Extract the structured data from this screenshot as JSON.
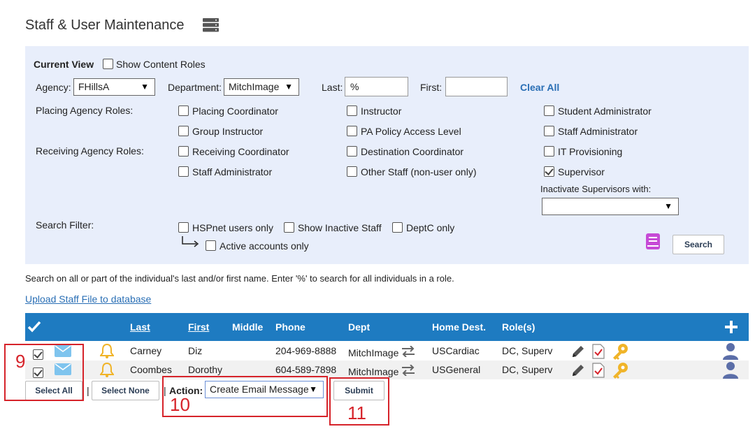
{
  "header": {
    "title": "Staff & User Maintenance",
    "title_icon": "server-icon"
  },
  "filters": {
    "current_view_label": "Current View",
    "show_content_roles": {
      "label": "Show Content Roles",
      "checked": false
    },
    "agency": {
      "label": "Agency:",
      "value": "FHillsA"
    },
    "department": {
      "label": "Department:",
      "value": "MitchImage"
    },
    "last": {
      "label": "Last:",
      "value": "%"
    },
    "first": {
      "label": "First:",
      "value": ""
    },
    "clear_all": "Clear All",
    "placing_roles_label": "Placing Agency Roles:",
    "receiving_roles_label": "Receiving Agency Roles:",
    "roles": [
      {
        "label": "Placing Coordinator",
        "checked": false
      },
      {
        "label": "Instructor",
        "checked": false
      },
      {
        "label": "Student Administrator",
        "checked": false
      },
      {
        "label": "Group Instructor",
        "checked": false
      },
      {
        "label": "PA Policy Access Level",
        "checked": false
      },
      {
        "label": "Staff Administrator",
        "checked": false
      },
      {
        "label": "Receiving Coordinator",
        "checked": false
      },
      {
        "label": "Destination Coordinator",
        "checked": false
      },
      {
        "label": "IT Provisioning",
        "checked": false
      },
      {
        "label": "Staff Administrator",
        "checked": false
      },
      {
        "label": "Other Staff (non-user only)",
        "checked": false
      },
      {
        "label": "Supervisor",
        "checked": true
      }
    ],
    "inactivate_label": "Inactivate Supervisors with:",
    "inactivate_value": "",
    "search_filter_label": "Search Filter:",
    "search_filters": [
      {
        "label": "HSPnet users only",
        "checked": false
      },
      {
        "label": "Show Inactive Staff",
        "checked": false
      },
      {
        "label": "DeptC only",
        "checked": false
      },
      {
        "label": "Active accounts only",
        "checked": false
      }
    ],
    "search_button": "Search"
  },
  "hint_text": "Search on all or part of the individual's last and/or first name. Enter '%' to search for all individuals in a role.",
  "upload_link": "Upload Staff File to database",
  "table": {
    "headers": {
      "last": "Last",
      "first": "First",
      "middle": "Middle",
      "phone": "Phone",
      "dept": "Dept",
      "home_dest": "Home Dest.",
      "roles": "Role(s)"
    },
    "rows": [
      {
        "checked": true,
        "last": "Carney",
        "first": "Diz",
        "middle": "",
        "phone": "204-969-8888",
        "dept": "MitchImage",
        "home_dest": "USCardiac",
        "roles": "DC, Superv"
      },
      {
        "checked": true,
        "last": "Coombes",
        "first": "Dorothy",
        "middle": "",
        "phone": "604-589-7898",
        "dept": "MitchImage",
        "home_dest": "USGeneral",
        "roles": "DC, Superv"
      }
    ]
  },
  "actions": {
    "select_all": "Select All",
    "select_none": "Select None",
    "separator": "|",
    "action_label": "Action:",
    "action_value": "Create Email Message",
    "submit": "Submit"
  },
  "annotations": {
    "n9": "9",
    "n10": "10",
    "n11": "11"
  },
  "colors": {
    "accent": "#1e7bc1",
    "panel": "#e8eefb",
    "annotation": "#d6232a",
    "bell": "#f0b429",
    "key": "#f0b429",
    "user": "#5b6ea8"
  }
}
